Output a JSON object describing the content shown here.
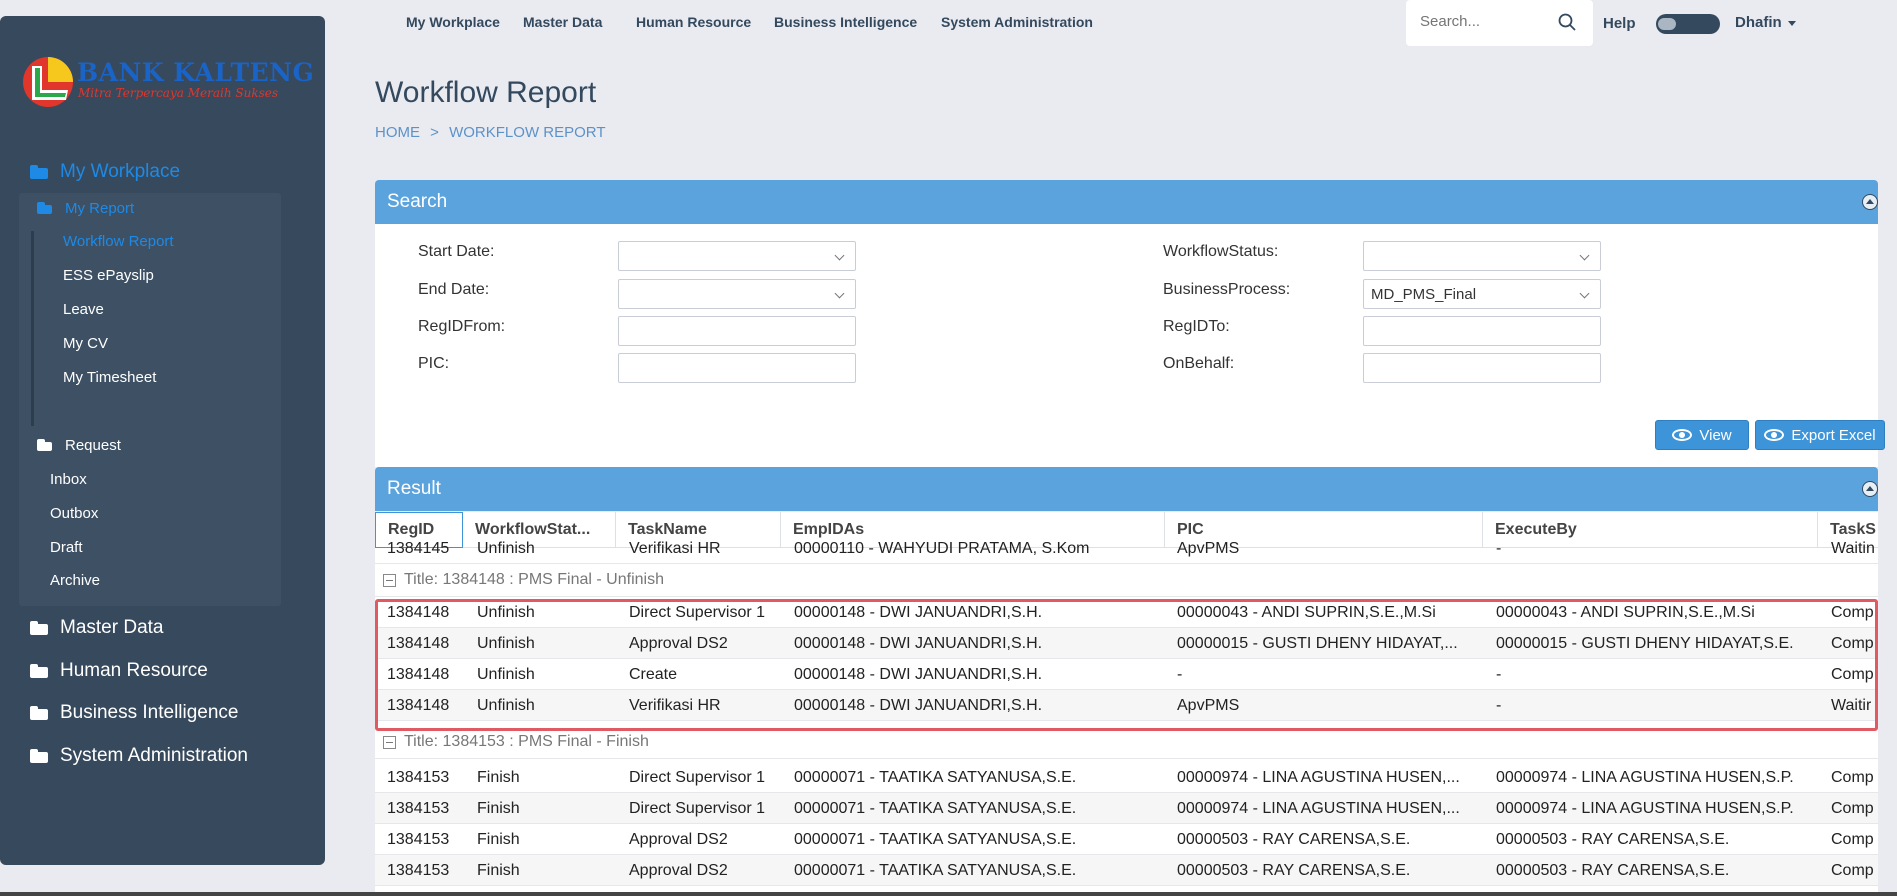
{
  "brand": {
    "name": "BANK KALTENG",
    "tagline": "Mitra Terpercaya Meraih Sukses"
  },
  "sidebar": {
    "main": [
      {
        "label": "My Workplace",
        "active": true
      },
      {
        "label": "Master Data"
      },
      {
        "label": "Human Resource"
      },
      {
        "label": "Business Intelligence"
      },
      {
        "label": "System Administration"
      }
    ],
    "my_report": {
      "label": "My Report",
      "items": [
        "Workflow Report",
        "ESS ePayslip",
        "Leave",
        "My CV",
        "My Timesheet"
      ]
    },
    "request": {
      "label": "Request",
      "items": [
        "Inbox",
        "Outbox",
        "Draft",
        "Archive"
      ]
    }
  },
  "topnav": [
    "My Workplace",
    "Master Data",
    "Human Resource",
    "Business Intelligence",
    "System Administration"
  ],
  "search": {
    "placeholder": "Search..."
  },
  "help_label": "Help",
  "user_name": "Dhafin",
  "page": {
    "title": "Workflow Report",
    "breadcrumb": [
      "HOME",
      ">",
      "WORKFLOW REPORT"
    ]
  },
  "search_panel": {
    "title": "Search",
    "fields": {
      "start_date": {
        "label": "Start Date:",
        "value": ""
      },
      "end_date": {
        "label": "End Date:",
        "value": ""
      },
      "regid_from": {
        "label": "RegIDFrom:",
        "value": ""
      },
      "pic": {
        "label": "PIC:",
        "value": ""
      },
      "workflow_status": {
        "label": "WorkflowStatus:",
        "value": ""
      },
      "business_process": {
        "label": "BusinessProcess:",
        "value": "MD_PMS_Final"
      },
      "regid_to": {
        "label": "RegIDTo:",
        "value": ""
      },
      "on_behalf": {
        "label": "OnBehalf:",
        "value": ""
      }
    },
    "view_button": "View",
    "export_button": "Export Excel"
  },
  "result": {
    "title": "Result",
    "columns": [
      "RegID",
      "WorkflowStat...",
      "TaskName",
      "EmpIDAs",
      "PIC",
      "ExecuteBy",
      "TaskS"
    ],
    "partial_row": [
      "1384145",
      "Unfinish",
      "Verifikasi HR",
      "00000110 - WAHYUDI PRATAMA, S.Kom",
      "ApvPMS",
      "-",
      "Waitin"
    ],
    "groups": [
      {
        "title": "Title: 1384148 : PMS Final - Unfinish",
        "rows": [
          [
            "1384148",
            "Unfinish",
            "Direct Supervisor 1",
            "00000148 - DWI JANUANDRI,S.H.",
            "00000043 - ANDI SUPRIN,S.E.,M.Si",
            "00000043 - ANDI SUPRIN,S.E.,M.Si",
            "Comp"
          ],
          [
            "1384148",
            "Unfinish",
            "Approval DS2",
            "00000148 - DWI JANUANDRI,S.H.",
            "00000015 - GUSTI DHENY HIDAYAT,...",
            "00000015 - GUSTI DHENY HIDAYAT,S.E.",
            "Comp"
          ],
          [
            "1384148",
            "Unfinish",
            "Create",
            "00000148 - DWI JANUANDRI,S.H.",
            "-",
            "-",
            "Comp"
          ],
          [
            "1384148",
            "Unfinish",
            "Verifikasi HR",
            "00000148 - DWI JANUANDRI,S.H.",
            "ApvPMS",
            "-",
            "Waitir"
          ]
        ]
      },
      {
        "title": "Title: 1384153 : PMS Final - Finish",
        "rows": [
          [
            "1384153",
            "Finish",
            "Direct Supervisor 1",
            "00000071 - TAATIKA SATYANUSA,S.E.",
            "00000974 - LINA AGUSTINA HUSEN,...",
            "00000974 - LINA AGUSTINA HUSEN,S.P.",
            "Comp"
          ],
          [
            "1384153",
            "Finish",
            "Direct Supervisor 1",
            "00000071 - TAATIKA SATYANUSA,S.E.",
            "00000974 - LINA AGUSTINA HUSEN,...",
            "00000974 - LINA AGUSTINA HUSEN,S.P.",
            "Comp"
          ],
          [
            "1384153",
            "Finish",
            "Approval DS2",
            "00000071 - TAATIKA SATYANUSA,S.E.",
            "00000503 - RAY CARENSA,S.E.",
            "00000503 - RAY CARENSA,S.E.",
            "Comp"
          ],
          [
            "1384153",
            "Finish",
            "Approval DS2",
            "00000071 - TAATIKA SATYANUSA,S.E.",
            "00000503 - RAY CARENSA,S.E.",
            "00000503 - RAY CARENSA,S.E.",
            "Comp"
          ]
        ]
      }
    ]
  },
  "colors": {
    "sidebar_bg": "#37495c",
    "accent": "#1e8ae6",
    "panel_header": "#5ba3dd",
    "highlight": "#e05a63"
  }
}
